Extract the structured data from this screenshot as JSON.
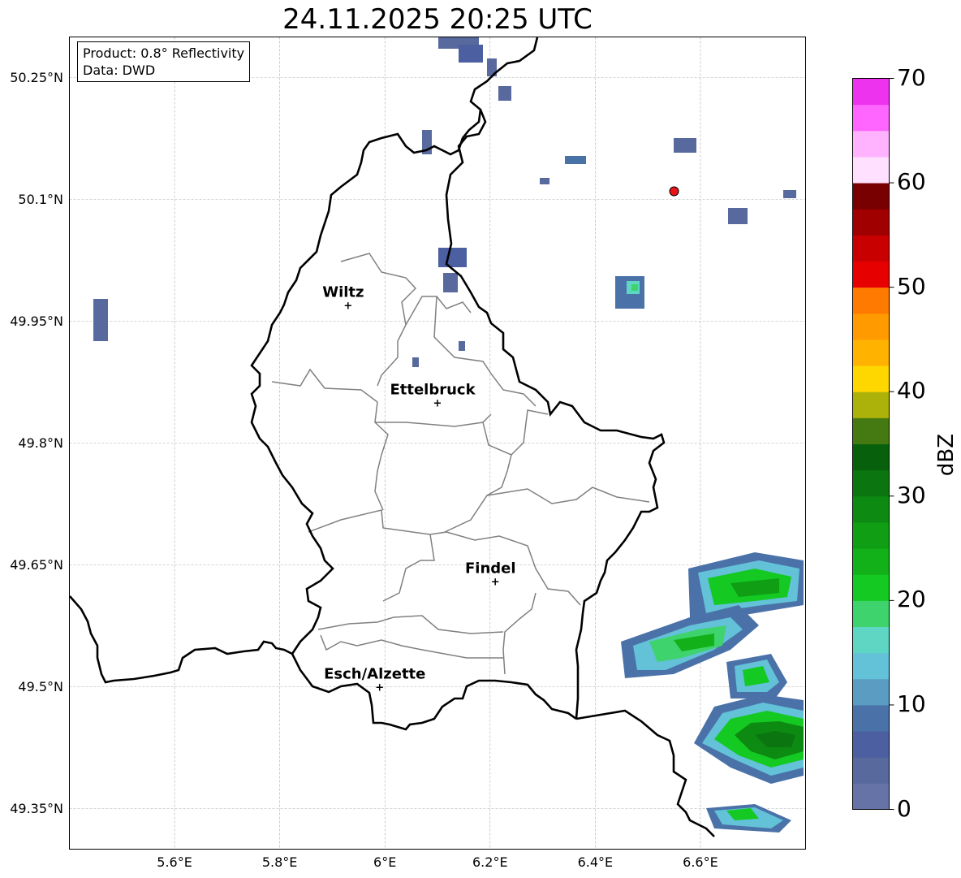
{
  "title": "24.11.2025 20:25 UTC",
  "info": {
    "line1": "Product: 0.8° Reflectivity",
    "line2": "Data: DWD"
  },
  "map": {
    "lon_range": [
      5.4,
      6.8
    ],
    "lat_range": [
      49.3,
      50.3
    ],
    "lon_ticks": [
      {
        "value": 5.6,
        "label": "5.6°E"
      },
      {
        "value": 5.8,
        "label": "5.8°E"
      },
      {
        "value": 6.0,
        "label": "6°E"
      },
      {
        "value": 6.2,
        "label": "6.2°E"
      },
      {
        "value": 6.4,
        "label": "6.4°E"
      },
      {
        "value": 6.6,
        "label": "6.6°E"
      }
    ],
    "lat_ticks": [
      {
        "value": 50.25,
        "label": "50.25°N"
      },
      {
        "value": 50.1,
        "label": "50.1°N"
      },
      {
        "value": 49.95,
        "label": "49.95°N"
      },
      {
        "value": 49.8,
        "label": "49.8°N"
      },
      {
        "value": 49.65,
        "label": "49.65°N"
      },
      {
        "value": 49.5,
        "label": "49.5°N"
      },
      {
        "value": 49.35,
        "label": "49.35°N"
      }
    ],
    "cities": [
      {
        "name": "Wiltz",
        "lon": 5.93,
        "lat": 49.97
      },
      {
        "name": "Ettelbruck",
        "lon": 6.1,
        "lat": 49.85
      },
      {
        "name": "Findel",
        "lon": 6.21,
        "lat": 49.63
      },
      {
        "name": "Esch/Alzette",
        "lon": 5.99,
        "lat": 49.5
      }
    ],
    "radar_site": {
      "lon": 6.55,
      "lat": 50.11,
      "color": "#e8141a"
    }
  },
  "colorbar": {
    "label": "dBZ",
    "ticks": [
      "0",
      "10",
      "20",
      "30",
      "40",
      "50",
      "60",
      "70"
    ],
    "colors": [
      "#6673a6",
      "#58699e",
      "#4c5fa0",
      "#4a72a8",
      "#5b9cc3",
      "#63c1d8",
      "#5fd6c3",
      "#3ed36c",
      "#14c922",
      "#12b11a",
      "#0f9e14",
      "#0d8a12",
      "#0b7510",
      "#07600c",
      "#457a12",
      "#adb20a",
      "#ffd700",
      "#ffb300",
      "#ff9a00",
      "#ff7a00",
      "#e60000",
      "#c80000",
      "#a00000",
      "#780000",
      "#ffe0ff",
      "#ffb3ff",
      "#ff66ff",
      "#ee33ee"
    ]
  }
}
